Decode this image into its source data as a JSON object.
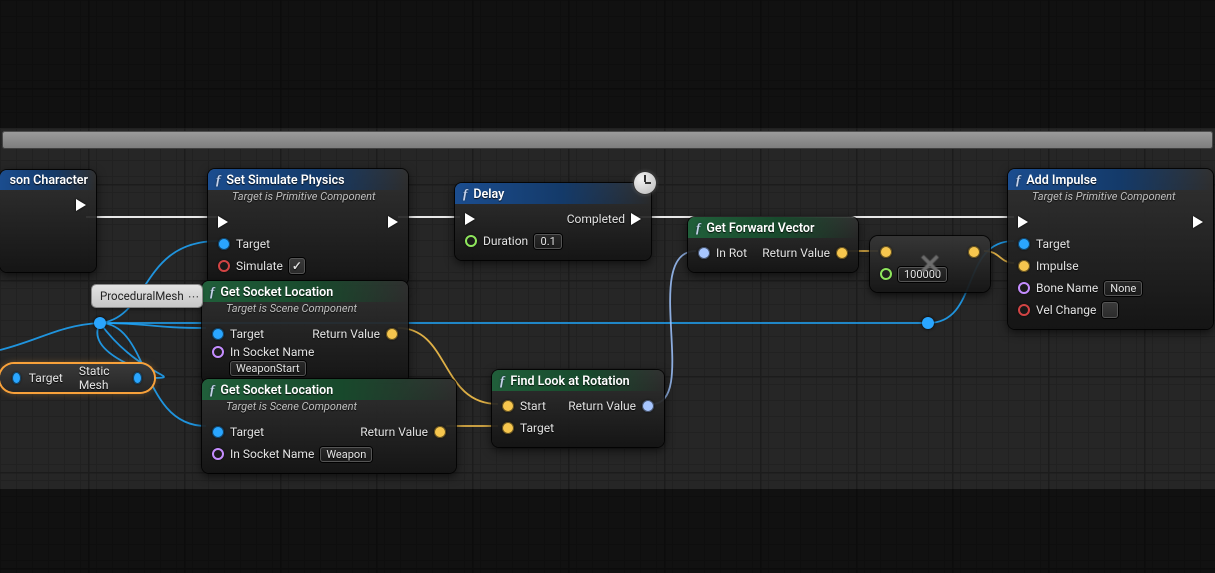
{
  "nodes": {
    "castPartial": {
      "title": "son Character"
    },
    "setSim": {
      "title": "Set Simulate Physics",
      "subtitle": "Target is Primitive Component",
      "targetLabel": "Target",
      "simulateLabel": "Simulate",
      "simulateChecked": "✓"
    },
    "getSocketA": {
      "title": "Get Socket Location",
      "subtitle": "Target is Scene Component",
      "targetLabel": "Target",
      "inSocketLabel": "In Socket Name",
      "inSocketValue": "WeaponStart",
      "returnLabel": "Return Value"
    },
    "getSocketB": {
      "title": "Get Socket Location",
      "subtitle": "Target is Scene Component",
      "targetLabel": "Target",
      "inSocketLabel": "In Socket Name",
      "inSocketValue": "Weapon",
      "returnLabel": "Return Value"
    },
    "delay": {
      "title": "Delay",
      "completedLabel": "Completed",
      "durationLabel": "Duration",
      "durationValue": "0.1"
    },
    "findLook": {
      "title": "Find Look at Rotation",
      "startLabel": "Start",
      "targetLabel": "Target",
      "returnLabel": "Return Value"
    },
    "getForward": {
      "title": "Get Forward Vector",
      "inRotLabel": "In Rot",
      "returnLabel": "Return Value"
    },
    "multiply": {
      "symbol": "✕",
      "floatValue": "100000"
    },
    "addImpulse": {
      "title": "Add Impulse",
      "subtitle": "Target is Primitive Component",
      "targetLabel": "Target",
      "impulseLabel": "Impulse",
      "boneLabel": "Bone Name",
      "boneValue": "None",
      "velLabel": "Vel Change"
    }
  },
  "pills": {
    "staticMesh": {
      "left": "Target",
      "right": "Static Mesh"
    },
    "procMesh": "ProceduralMesh"
  },
  "colors": {
    "exec": "#ffffff",
    "object": "#2aa6ff",
    "vector": "#f6c64e",
    "rotator": "#a7c6ff",
    "float": "#8ee65c",
    "bool": "#d24444",
    "name": "#c58dff"
  }
}
